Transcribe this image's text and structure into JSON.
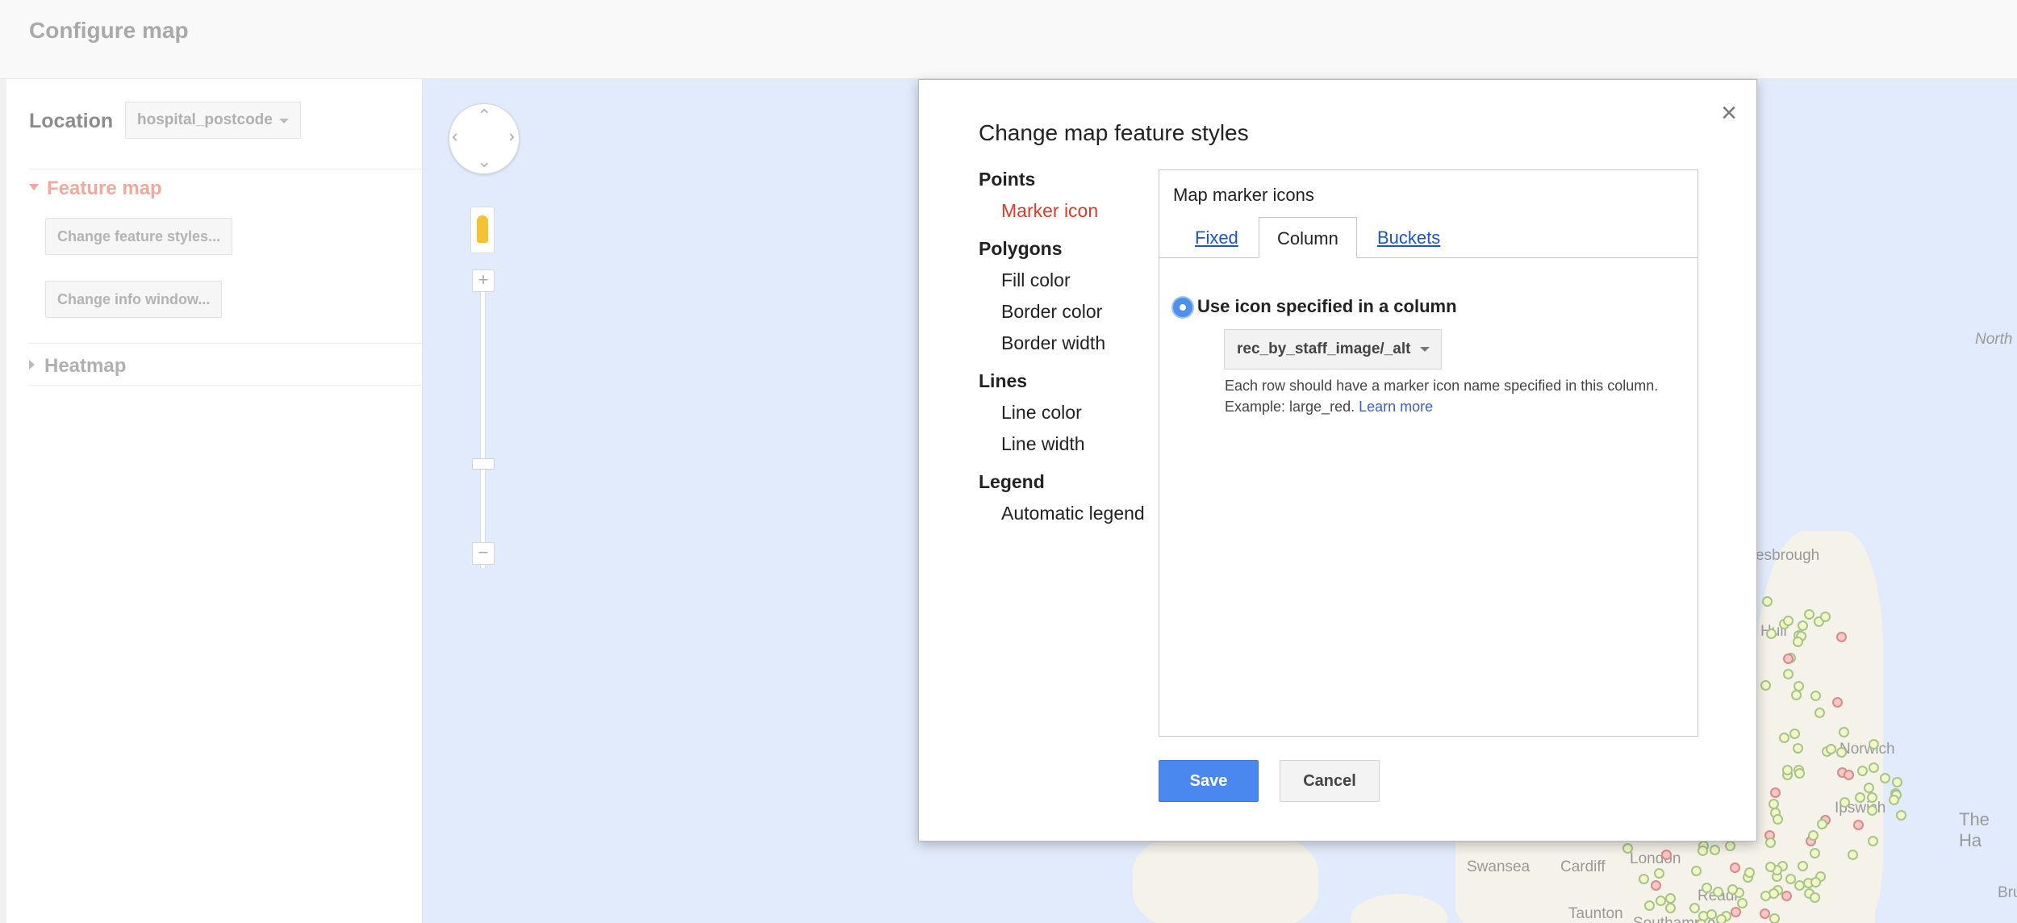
{
  "header": {
    "title": "Configure map"
  },
  "sidebar": {
    "location_label": "Location",
    "location_value": "hospital_postcode",
    "feature_map_label": "Feature map",
    "change_styles_button": "Change feature styles...",
    "change_info_button": "Change info window...",
    "heatmap_label": "Heatmap",
    "accent_color": "#f0a99a"
  },
  "map": {
    "labels": {
      "north": "North",
      "middlesbrough": "esbrough",
      "hull": "Hull",
      "norwich": "Norwich",
      "ipswich": "Ipswich",
      "the_hague": "The Ha",
      "swansea": "Swansea",
      "cardiff": "Cardiff",
      "london": "London",
      "reading": "Readi",
      "taunton": "Taunton",
      "bruges": "Bruges",
      "southampton": "Southampton"
    }
  },
  "dialog": {
    "title": "Change map feature styles",
    "close_icon": "×",
    "nav": {
      "points": "Points",
      "marker_icon": "Marker icon",
      "polygons": "Polygons",
      "fill_color": "Fill color",
      "border_color": "Border color",
      "border_width": "Border width",
      "lines": "Lines",
      "line_color": "Line color",
      "line_width": "Line width",
      "legend": "Legend",
      "automatic_legend": "Automatic legend"
    },
    "panel": {
      "title": "Map marker icons",
      "tabs": {
        "fixed": "Fixed",
        "column": "Column",
        "buckets": "Buckets"
      },
      "radio_label": "Use icon specified in a column",
      "column_value": "rec_by_staff_image/_alt",
      "help_line1": "Each row should have a marker icon name specified in this column.",
      "help_line2": "Example: large_red.",
      "learn_more": "Learn more"
    },
    "save_label": "Save",
    "cancel_label": "Cancel",
    "active_color": "#dd3b2a",
    "primary_color": "#4a87ee"
  }
}
